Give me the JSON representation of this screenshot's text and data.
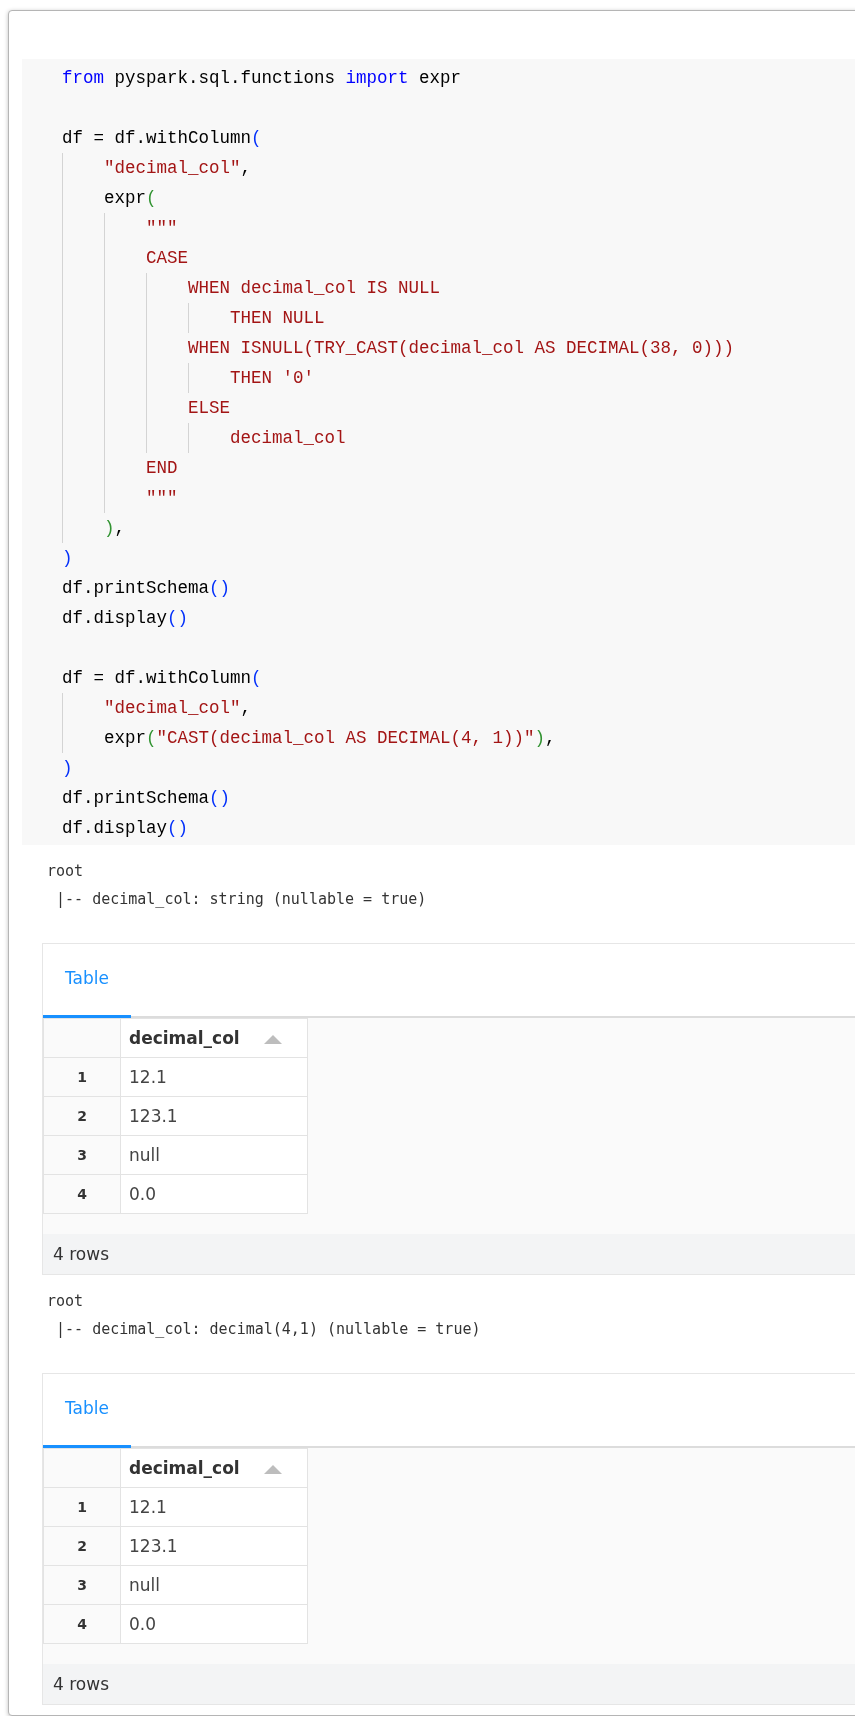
{
  "code_cell": {
    "lines": [
      {
        "kind": "code",
        "tokens": [
          {
            "text": "from",
            "kind": "keyword"
          },
          {
            "text": " pyspark.sql.functions ",
            "kind": "plain"
          },
          {
            "text": "import",
            "kind": "keyword"
          },
          {
            "text": " expr",
            "kind": "plain"
          }
        ]
      },
      {
        "kind": "blank"
      },
      {
        "kind": "code",
        "tokens": [
          {
            "text": "df = df.withColumn",
            "kind": "plain"
          },
          {
            "text": "(",
            "kind": "bracket1"
          }
        ]
      },
      {
        "kind": "code",
        "tokens": [
          {
            "text": "    \"decimal_col\"",
            "kind": "string"
          },
          {
            "text": ",",
            "kind": "plain"
          }
        ]
      },
      {
        "kind": "code",
        "tokens": [
          {
            "text": "    expr",
            "kind": "plain"
          },
          {
            "text": "(",
            "kind": "bracket2"
          }
        ]
      },
      {
        "kind": "code",
        "tokens": [
          {
            "text": "        \"\"\"",
            "kind": "string"
          }
        ]
      },
      {
        "kind": "code",
        "tokens": [
          {
            "text": "        CASE",
            "kind": "string"
          }
        ]
      },
      {
        "kind": "code",
        "tokens": [
          {
            "text": "            WHEN decimal_col IS NULL",
            "kind": "string"
          }
        ]
      },
      {
        "kind": "code",
        "tokens": [
          {
            "text": "                THEN NULL",
            "kind": "string"
          }
        ]
      },
      {
        "kind": "code",
        "tokens": [
          {
            "text": "            WHEN ISNULL(TRY_CAST(decimal_col AS DECIMAL(38, 0)))",
            "kind": "string"
          }
        ]
      },
      {
        "kind": "code",
        "tokens": [
          {
            "text": "                THEN '0'",
            "kind": "string"
          }
        ]
      },
      {
        "kind": "code",
        "tokens": [
          {
            "text": "            ELSE",
            "kind": "string"
          }
        ]
      },
      {
        "kind": "code",
        "tokens": [
          {
            "text": "                decimal_col",
            "kind": "string"
          }
        ]
      },
      {
        "kind": "code",
        "tokens": [
          {
            "text": "        END",
            "kind": "string"
          }
        ]
      },
      {
        "kind": "code",
        "tokens": [
          {
            "text": "        \"\"\"",
            "kind": "string"
          }
        ]
      },
      {
        "kind": "code",
        "tokens": [
          {
            "text": "    )",
            "kind": "bracket2"
          },
          {
            "text": ",",
            "kind": "plain"
          }
        ]
      },
      {
        "kind": "code",
        "tokens": [
          {
            "text": ")",
            "kind": "bracket1"
          }
        ]
      },
      {
        "kind": "code",
        "tokens": [
          {
            "text": "df.printSchema",
            "kind": "plain"
          },
          {
            "text": "()",
            "kind": "bracket1"
          }
        ]
      },
      {
        "kind": "code",
        "tokens": [
          {
            "text": "df.display",
            "kind": "plain"
          },
          {
            "text": "()",
            "kind": "bracket1"
          }
        ]
      },
      {
        "kind": "blank"
      },
      {
        "kind": "code",
        "tokens": [
          {
            "text": "df = df.withColumn",
            "kind": "plain"
          },
          {
            "text": "(",
            "kind": "bracket1"
          }
        ]
      },
      {
        "kind": "code",
        "tokens": [
          {
            "text": "    \"decimal_col\"",
            "kind": "string"
          },
          {
            "text": ",",
            "kind": "plain"
          }
        ]
      },
      {
        "kind": "code",
        "tokens": [
          {
            "text": "    expr",
            "kind": "plain"
          },
          {
            "text": "(",
            "kind": "bracket2"
          },
          {
            "text": "\"CAST(decimal_col AS DECIMAL(4, 1))\"",
            "kind": "string"
          },
          {
            "text": ")",
            "kind": "bracket2"
          },
          {
            "text": ",",
            "kind": "plain"
          }
        ]
      },
      {
        "kind": "code",
        "tokens": [
          {
            "text": ")",
            "kind": "bracket1"
          }
        ]
      },
      {
        "kind": "code",
        "tokens": [
          {
            "text": "df.printSchema",
            "kind": "plain"
          },
          {
            "text": "()",
            "kind": "bracket1"
          }
        ]
      },
      {
        "kind": "code",
        "tokens": [
          {
            "text": "df.display",
            "kind": "plain"
          },
          {
            "text": "()",
            "kind": "bracket1"
          }
        ]
      }
    ]
  },
  "outputs": [
    {
      "schema_lines": [
        "root",
        " |-- decimal_col: string (nullable = true)"
      ],
      "tabs": [
        {
          "label": "Table",
          "selected": true
        }
      ],
      "table": {
        "columns": [
          "decimal_col"
        ],
        "rows": [
          {
            "index": "1",
            "cells": [
              "12.1"
            ]
          },
          {
            "index": "2",
            "cells": [
              "123.1"
            ]
          },
          {
            "index": "3",
            "cells": [
              "null"
            ]
          },
          {
            "index": "4",
            "cells": [
              "0.0"
            ]
          }
        ]
      },
      "footer": "4 rows"
    },
    {
      "schema_lines": [
        "root",
        " |-- decimal_col: decimal(4,1) (nullable = true)"
      ],
      "tabs": [
        {
          "label": "Table",
          "selected": true
        }
      ],
      "table": {
        "columns": [
          "decimal_col"
        ],
        "rows": [
          {
            "index": "1",
            "cells": [
              "12.1"
            ]
          },
          {
            "index": "2",
            "cells": [
              "123.1"
            ]
          },
          {
            "index": "3",
            "cells": [
              "null"
            ]
          },
          {
            "index": "4",
            "cells": [
              "0.0"
            ]
          }
        ]
      },
      "footer": "4 rows"
    }
  ]
}
